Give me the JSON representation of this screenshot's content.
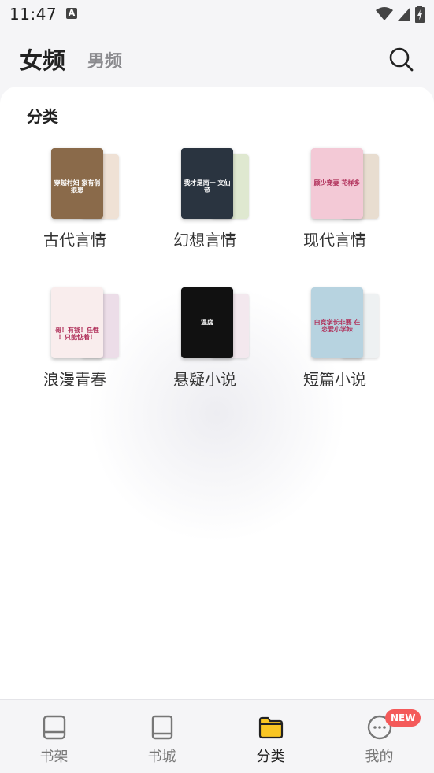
{
  "status_bar": {
    "time": "11:47",
    "a_icon": "A"
  },
  "header": {
    "tab_active": "女频",
    "tab_inactive": "男频",
    "search_icon": "search-icon"
  },
  "section": {
    "title": "分类"
  },
  "categories": [
    {
      "label": "古代言情",
      "cover_text": "穿越村妇 家有俏狼崽",
      "colors": {
        "front": "#8a6a4a",
        "back": "#efe1d5"
      }
    },
    {
      "label": "幻想言情",
      "cover_text": "我才是南一 文仙帝",
      "colors": {
        "front": "#2a3440",
        "back": "#dfe8d0"
      }
    },
    {
      "label": "现代言情",
      "cover_text": "顾少宠妻 花样多",
      "colors": {
        "front": "#f3c9d6",
        "back": "#e8ddd0"
      }
    },
    {
      "label": "浪漫青春",
      "cover_text": "哥！有钱！任性 ！只能惦着！",
      "colors": {
        "front": "#f9eded",
        "back": "#ecdde8"
      }
    },
    {
      "label": "悬疑小说",
      "cover_text": "温度",
      "colors": {
        "front": "#111111",
        "back": "#f3e8ee"
      }
    },
    {
      "label": "短篇小说",
      "cover_text": "白竞学长非要 在恋爱小学妹",
      "colors": {
        "front": "#b7d3e0",
        "back": "#eef1f2"
      }
    }
  ],
  "bottom_nav": [
    {
      "label": "书架",
      "icon": "book-outline-icon",
      "active": false
    },
    {
      "label": "书城",
      "icon": "book-open-icon",
      "active": false
    },
    {
      "label": "分类",
      "icon": "folder-icon",
      "active": true
    },
    {
      "label": "我的",
      "icon": "profile-chat-icon",
      "active": false
    }
  ],
  "badge": {
    "text": "NEW"
  },
  "colors": {
    "accent": "#f9c623",
    "badge": "#f45a5a"
  }
}
